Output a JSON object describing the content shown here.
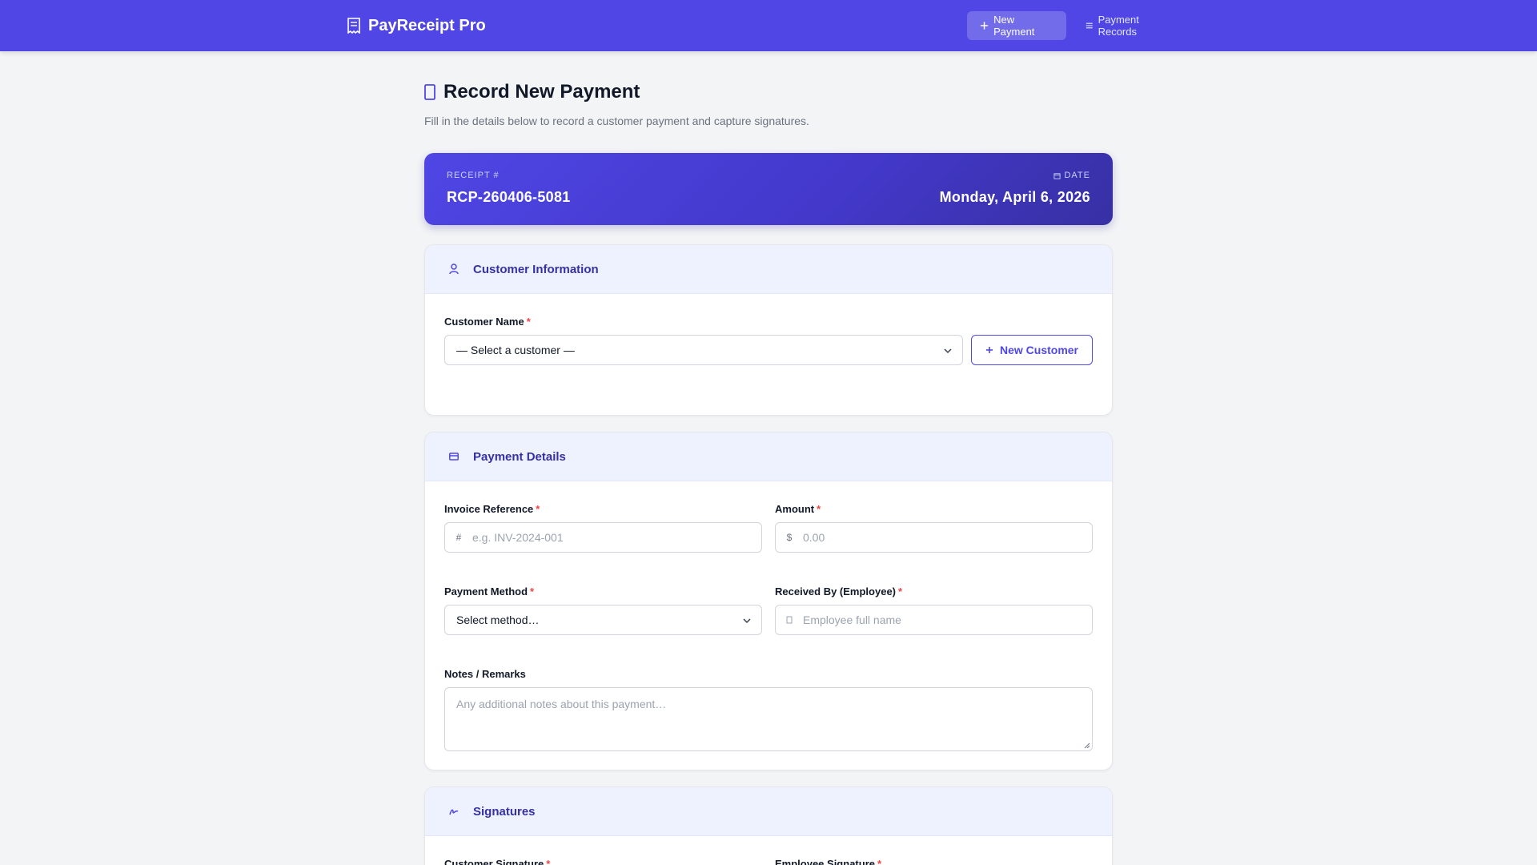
{
  "app": {
    "name": "PayReceipt Pro",
    "brand_icon": "receipt-icon"
  },
  "nav": {
    "new_payment": "New Payment",
    "payment_records": "Payment Records",
    "active": "new_payment"
  },
  "page": {
    "title": "Record New Payment",
    "subtitle": "Fill in the details below to record a customer payment and capture signatures."
  },
  "receipt": {
    "number_label": "RECEIPT #",
    "number": "RCP-260406-5081",
    "date_label": "DATE",
    "date": "Monday, April 6, 2026"
  },
  "customer_section": {
    "title": "Customer Information",
    "name_label": "Customer Name",
    "select_value": "— Select a customer —",
    "new_customer_button": "New Customer"
  },
  "payment_section": {
    "title": "Payment Details",
    "invoice_label": "Invoice Reference",
    "invoice_prefix": "#",
    "invoice_placeholder": "e.g. INV-2024-001",
    "amount_label": "Amount",
    "amount_prefix": "$",
    "amount_placeholder": "0.00",
    "method_label": "Payment Method",
    "method_value": "Select method…",
    "received_label": "Received By (Employee)",
    "received_placeholder": "Employee full name",
    "notes_label": "Notes / Remarks",
    "notes_placeholder": "Any additional notes about this payment…"
  },
  "signature_section": {
    "title": "Signatures",
    "customer_sig_label": "Customer Signature",
    "employee_sig_label": "Employee Signature"
  },
  "required_marker": "*",
  "colors": {
    "primary": "#4f46e5",
    "primary_dark": "#3730a3",
    "section_header_bg": "#eef2ff",
    "required": "#ef4444",
    "page_bg": "#f3f4f6"
  }
}
